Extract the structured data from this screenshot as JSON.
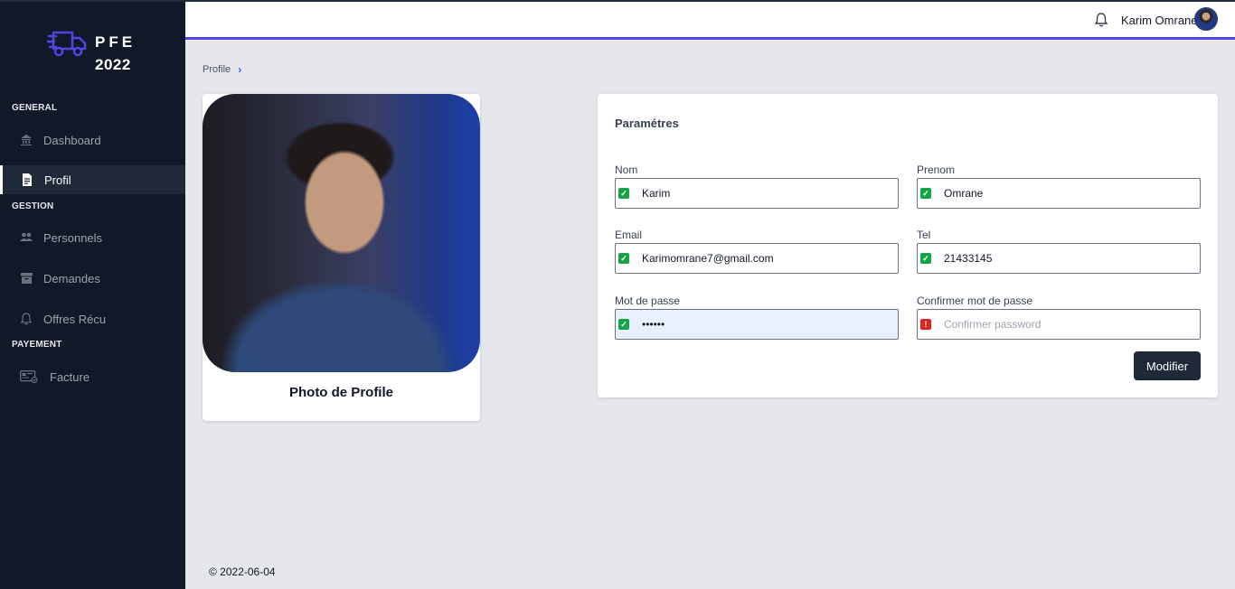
{
  "brand": {
    "line1": "PFE",
    "line2": "2022"
  },
  "sidebar": {
    "sections": [
      {
        "label": "GENERAL"
      },
      {
        "label": "GESTION"
      },
      {
        "label": "PAYEMENT"
      }
    ],
    "items": [
      {
        "label": "Dashboard",
        "icon": "bank-icon"
      },
      {
        "label": "Profil",
        "icon": "document-icon",
        "active": true
      },
      {
        "label": "Personnels",
        "icon": "users-icon"
      },
      {
        "label": "Demandes",
        "icon": "archive-icon"
      },
      {
        "label": "Offres Récu",
        "icon": "bell-icon"
      },
      {
        "label": "Facture",
        "icon": "invoice-icon"
      }
    ]
  },
  "header": {
    "user_name": "Karim Omrane"
  },
  "breadcrumb": {
    "label": "Profile"
  },
  "profile": {
    "photo_label": "Photo de Profile"
  },
  "settings": {
    "title": "Paramétres",
    "fields": {
      "nom": {
        "label": "Nom",
        "value": "Karim",
        "status": "valid"
      },
      "prenom": {
        "label": "Prenom",
        "value": "Omrane",
        "status": "valid"
      },
      "email": {
        "label": "Email",
        "value": "Karimomrane7@gmail.com",
        "status": "valid"
      },
      "tel": {
        "label": "Tel",
        "value": "21433145",
        "status": "valid"
      },
      "password": {
        "label": "Mot de passe",
        "value": "••••••",
        "status": "valid"
      },
      "confirm": {
        "label": "Confirmer mot de passe",
        "placeholder": "Confirmer password",
        "status": "error"
      }
    },
    "submit_label": "Modifier"
  },
  "footer": {
    "text": "© 2022-06-04"
  },
  "colors": {
    "sidebar_bg": "#111827",
    "accent": "#5046e5",
    "valid": "#16a34a",
    "error": "#dc2626",
    "button": "#1f2937"
  }
}
